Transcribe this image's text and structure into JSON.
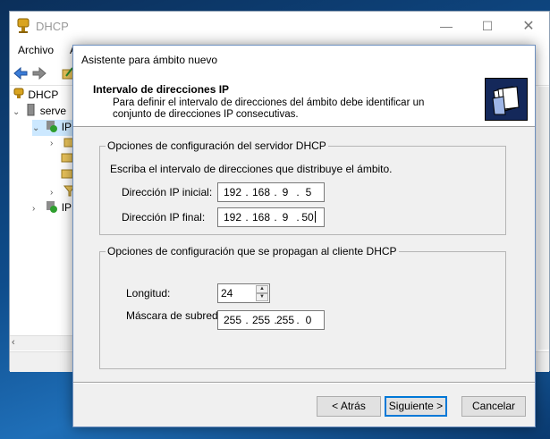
{
  "dhcp_window": {
    "title": "DHCP",
    "controls": {
      "minimize": "—",
      "maximize": "☐",
      "close": "✕"
    },
    "menu": [
      "Archivo",
      "A"
    ],
    "tree": {
      "root": "DHCP",
      "server": "serve",
      "ipv4": "IP",
      "ipv6": "IP"
    }
  },
  "wizard": {
    "title": "Asistente para ámbito nuevo",
    "heading": "Intervalo de direcciones IP",
    "description": "Para definir el intervalo de direcciones del ámbito debe identificar un conjunto de direcciones IP consecutivas.",
    "server_group": {
      "legend": "Opciones de configuración del servidor DHCP",
      "instruction": "Escriba el intervalo de direcciones que distribuye el ámbito.",
      "start_label": "Dirección IP inicial:",
      "start_ip": [
        "192",
        "168",
        "9",
        "5"
      ],
      "end_label": "Dirección IP final:",
      "end_ip": [
        "192",
        "168",
        "9",
        "50"
      ]
    },
    "client_group": {
      "legend": "Opciones de configuración que se propagan al cliente DHCP",
      "length_label": "Longitud:",
      "length_value": "24",
      "mask_label": "Máscara de subred:",
      "mask_ip": [
        "255",
        "255",
        "255",
        "0"
      ]
    },
    "buttons": {
      "back": "< Atrás",
      "next": "Siguiente >",
      "cancel": "Cancelar"
    }
  }
}
